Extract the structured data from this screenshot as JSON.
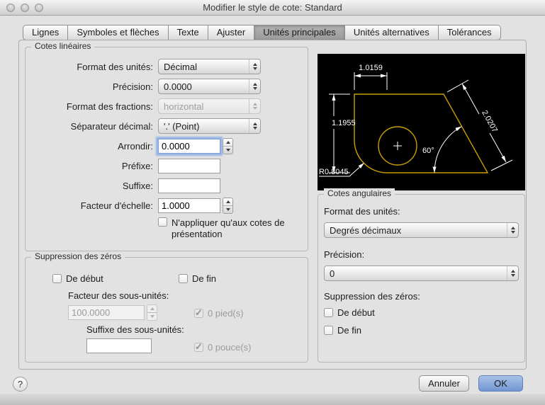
{
  "window": {
    "title": "Modifier le style de cote: Standard"
  },
  "tabs": [
    {
      "label": "Lignes"
    },
    {
      "label": "Symboles et flèches"
    },
    {
      "label": "Texte"
    },
    {
      "label": "Ajuster"
    },
    {
      "label": "Unités principales"
    },
    {
      "label": "Unités alternatives"
    },
    {
      "label": "Tolérances"
    }
  ],
  "linear": {
    "group_title": "Cotes linéaires",
    "format_label": "Format des unités:",
    "format_value": "Décimal",
    "precision_label": "Précision:",
    "precision_value": "0.0000",
    "fraction_label": "Format des fractions:",
    "fraction_value": "horizontal",
    "separator_label": "Séparateur décimal:",
    "separator_value": "'.' (Point)",
    "round_label": "Arrondir:",
    "round_value": "0.0000",
    "prefix_label": "Préfixe:",
    "suffix_label": "Suffixe:",
    "scale_label": "Facteur d'échelle:",
    "scale_value": "1.0000",
    "layout_only_checkbox": "N'appliquer qu'aux cotes de présentation"
  },
  "zeros": {
    "group_title": "Suppression des zéros",
    "leading": "De début",
    "trailing": "De fin",
    "subunit_factor_label": "Facteur des sous-unités:",
    "subunit_factor_value": "100.0000",
    "feet_checkbox": "0 pied(s)",
    "subunit_suffix_label": "Suffixe des sous-unités:",
    "inches_checkbox": "0 pouce(s)"
  },
  "preview": {
    "dim_top": "1.0159",
    "dim_left": "1.1955",
    "dim_diag": "2.0207",
    "dim_angle": "60°",
    "dim_radius": "R0.8045",
    "shape_color": "#c8a000",
    "dim_color": "#ffffff",
    "bg_color": "#000000"
  },
  "angular": {
    "group_title": "Cotes angulaires",
    "format_label": "Format des unités:",
    "format_value": "Degrés décimaux",
    "precision_label": "Précision:",
    "precision_value": "0",
    "zeros_label": "Suppression des zéros:",
    "leading": "De début",
    "trailing": "De fin"
  },
  "footer": {
    "help": "?",
    "cancel": "Annuler",
    "ok": "OK"
  }
}
